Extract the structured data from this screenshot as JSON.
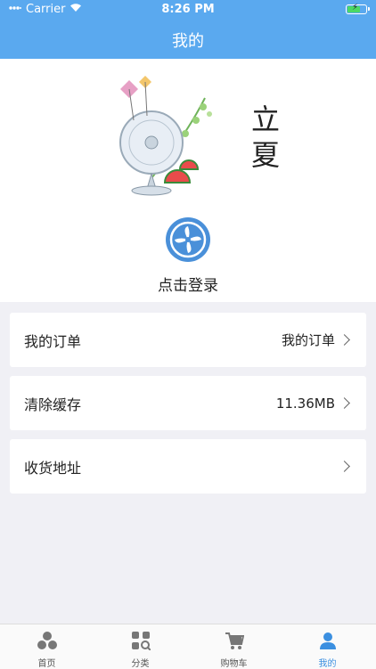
{
  "status_bar": {
    "carrier": "Carrier",
    "time": "8:26 PM"
  },
  "nav": {
    "title": "我的"
  },
  "header": {
    "banner_text": "立夏",
    "login_label": "点击登录"
  },
  "rows": [
    {
      "label": "我的订单",
      "value": "我的订单"
    },
    {
      "label": "清除缓存",
      "value": "11.36MB"
    },
    {
      "label": "收货地址",
      "value": ""
    }
  ],
  "tabs": [
    {
      "label": "首页",
      "icon": "home-icon"
    },
    {
      "label": "分类",
      "icon": "category-icon"
    },
    {
      "label": "购物车",
      "icon": "cart-icon"
    },
    {
      "label": "我的",
      "icon": "profile-icon",
      "active": true
    }
  ],
  "colors": {
    "nav_bg": "#5aa9ef",
    "accent": "#3b8fe0",
    "page_bg": "#f0f0f5"
  }
}
